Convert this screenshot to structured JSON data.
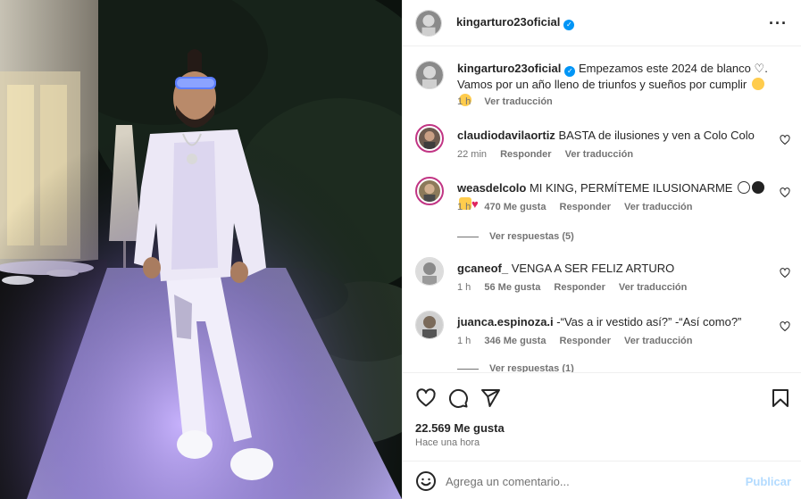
{
  "post": {
    "author": "kingarturo23oficial",
    "verified_icon": "verified-badge-icon",
    "more_icon": "more-options-icon",
    "caption_line1": "Empezamos este 2024 de blanco",
    "caption_line2": "Vamos por un año lleno de triunfos y sueños por cumplir",
    "caption_time": "1 h",
    "caption_translate": "Ver traducción"
  },
  "comments": [
    {
      "user": "claudiodavilaortiz",
      "text": "BASTA de ilusiones y ven a Colo Colo",
      "time": "22 min",
      "likes": "",
      "reply": "Responder",
      "translate": "Ver traducción"
    },
    {
      "user": "weasdelcolo",
      "text": "MI KING, PERMÍTEME ILUSIONARME",
      "time": "1 h",
      "likes": "470 Me gusta",
      "reply": "Responder",
      "translate": "Ver traducción",
      "view_replies": "Ver respuestas (5)"
    },
    {
      "user": "gcaneof_",
      "text": "VENGA A SER FELIZ ARTURO",
      "time": "1 h",
      "likes": "56 Me gusta",
      "reply": "Responder",
      "translate": "Ver traducción"
    },
    {
      "user": "juanca.espinoza.i",
      "text": "-“Vas a ir vestido así?” -“Así como?”",
      "time": "1 h",
      "likes": "346 Me gusta",
      "reply": "Responder",
      "translate": "Ver traducción",
      "view_replies": "Ver respuestas (1)"
    }
  ],
  "actions": {
    "like_icon": "heart-icon",
    "comment_icon": "comment-icon",
    "share_icon": "send-icon",
    "save_icon": "bookmark-icon",
    "likes_count": "22.569 Me gusta",
    "posted": "Hace una hora"
  },
  "composer": {
    "placeholder": "Agrega un comentario...",
    "publish": "Publicar",
    "emoji_icon": "emoji-icon"
  },
  "colors": {
    "accent": "#0095f6",
    "publish_disabled": "#b3dbff",
    "story_ring": "#c13584",
    "like_red": "#ed4956"
  }
}
